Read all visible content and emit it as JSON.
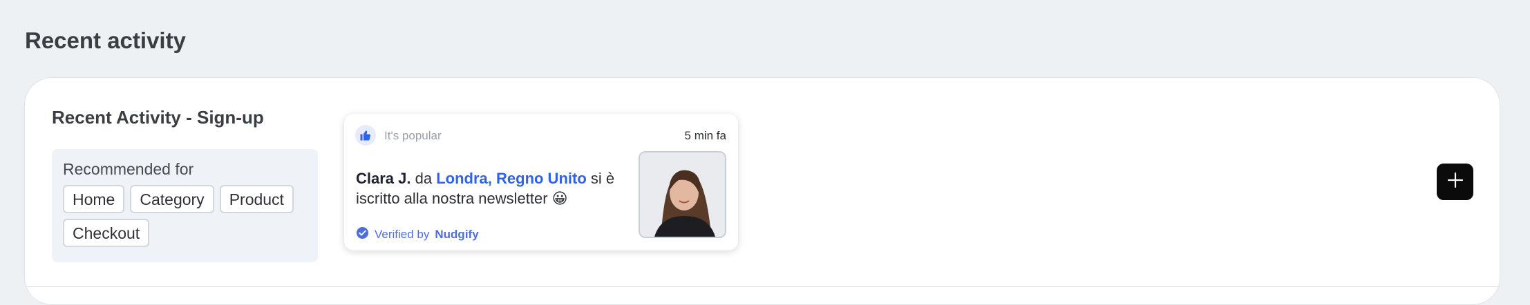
{
  "page": {
    "title": "Recent activity"
  },
  "card": {
    "section_title": "Recent Activity - Sign-up",
    "recommended": {
      "label": "Recommended for",
      "tags": [
        "Home",
        "Category",
        "Product",
        "Checkout"
      ]
    },
    "notification": {
      "icon": "thumbs-up-icon",
      "popular_label": "It's popular",
      "time": "5 min fa",
      "name": "Clara J.",
      "from_word": "da",
      "location": "Londra, Regno Unito",
      "rest": "si è iscritto alla nostra newsletter 😀",
      "verified_prefix": "Verified by",
      "verified_brand": "Nudgify",
      "accent_color": "#2f63e6"
    },
    "add_button": {
      "icon": "plus-icon"
    }
  }
}
